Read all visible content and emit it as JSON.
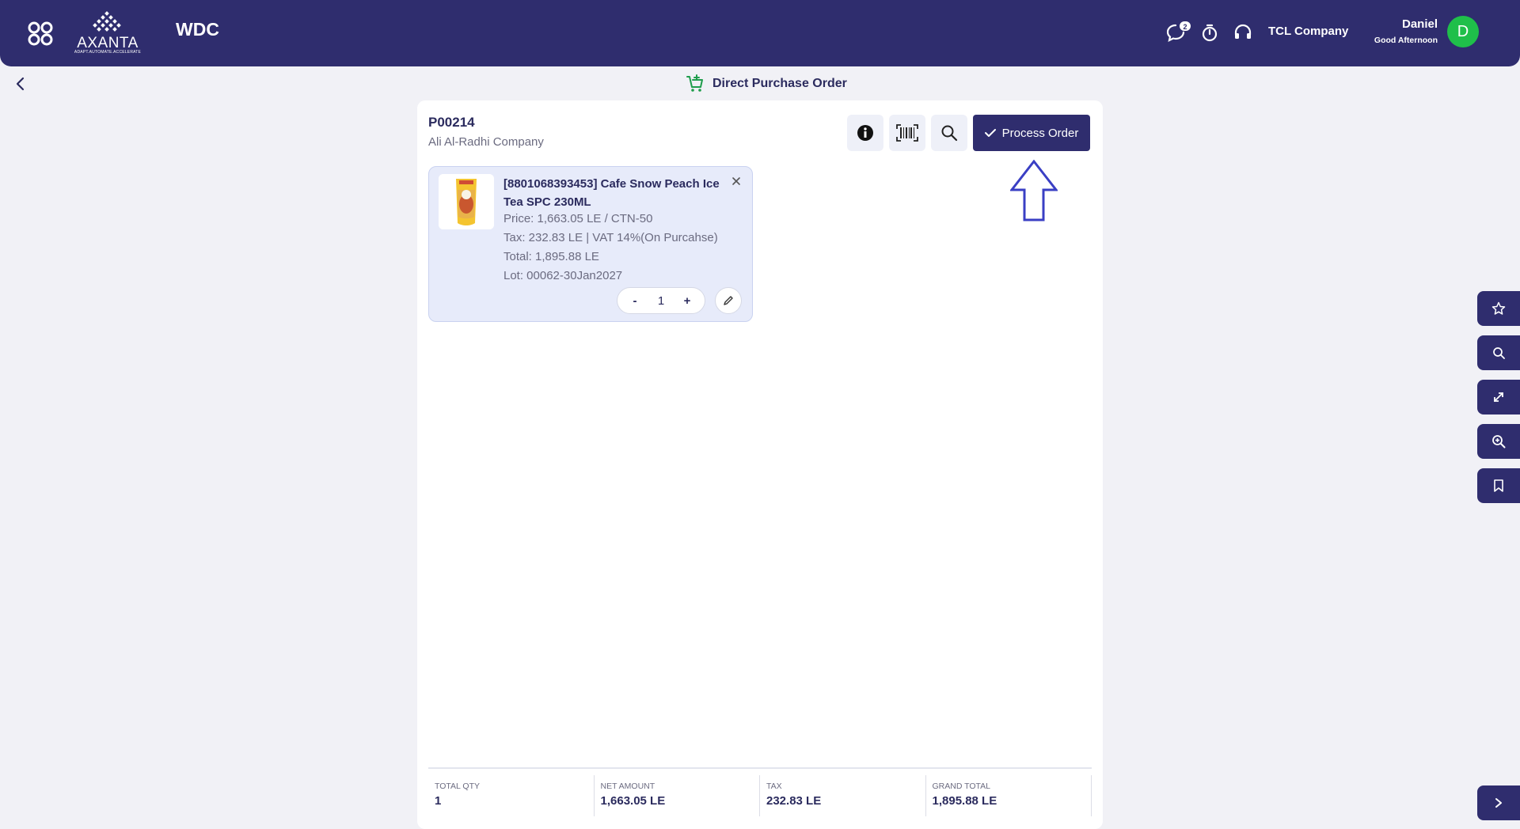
{
  "header": {
    "app_name": "WDC",
    "logo_text": "AXANTA",
    "logo_tagline": "ADAPT.AUTOMATE.ACCELERATE",
    "chat_badge_count": "2",
    "company": "TCL Company",
    "user_name": "Daniel",
    "greeting": "Good Afternoon",
    "avatar_initial": "D",
    "icons": [
      "apps-grid-icon",
      "chat-icon",
      "timer-icon",
      "headset-icon"
    ]
  },
  "page": {
    "title": "Direct Purchase Order",
    "back_icon": "chevron-left-icon",
    "title_icon": "cart-plus-icon"
  },
  "order": {
    "number": "P00214",
    "vendor": "Ali Al-Radhi Company",
    "toolbar": {
      "info_icon": "info-icon",
      "barcode_icon": "barcode-scan-icon",
      "search_icon": "search-icon",
      "process_label": "Process Order"
    },
    "items": [
      {
        "title": "[8801068393453] Cafe Snow Peach Ice Tea SPC 230ML",
        "price": "Price: 1,663.05 LE / CTN-50",
        "tax": "Tax: 232.83 LE | VAT 14%(On Purcahse)",
        "total": "Total: 1,895.88 LE",
        "lot": "Lot: 00062-30Jan2027",
        "qty": "1",
        "dec_label": "-",
        "inc_label": "+"
      }
    ],
    "totals": [
      {
        "label": "TOTAL QTY",
        "value": "1"
      },
      {
        "label": "NET AMOUNT",
        "value": "1,663.05 LE"
      },
      {
        "label": "TAX",
        "value": "232.83 LE"
      },
      {
        "label": "GRAND TOTAL",
        "value": "1,895.88 LE"
      }
    ]
  },
  "dock": [
    "star-icon",
    "search-icon",
    "expand-icon",
    "zoom-in-icon",
    "bookmark-icon",
    "chevron-right-icon"
  ],
  "colors": {
    "primary": "#2f2d6e",
    "item_bg": "#e7ebfa",
    "avatar": "#1fbf4a",
    "cart_icon": "#1f9d4c",
    "hint_arrow": "#3a3fc4"
  }
}
